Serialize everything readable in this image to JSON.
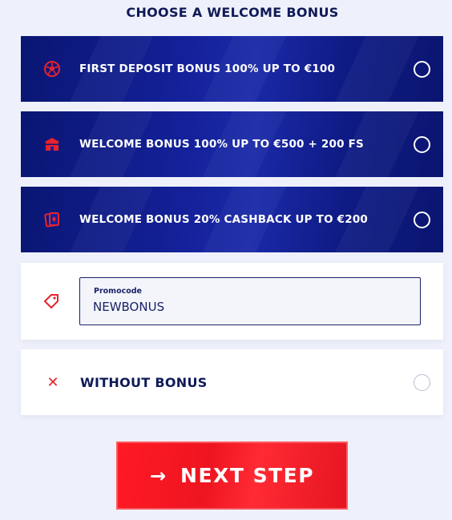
{
  "title": "CHOOSE A WELCOME BONUS",
  "options": [
    {
      "label": "FIRST DEPOSIT BONUS 100% UP TO €100",
      "icon": "soccer-ball-icon"
    },
    {
      "label": "WELCOME BONUS 100% UP TO €500 + 200 FS",
      "icon": "casino-building-icon"
    },
    {
      "label": "WELCOME BONUS 20% CASHBACK UP TO €200",
      "icon": "playing-cards-icon"
    }
  ],
  "promo": {
    "icon": "tag-icon",
    "label": "Promocode",
    "value": "NEWBONUS"
  },
  "without_bonus": {
    "icon": "close-icon",
    "label": "WITHOUT BONUS"
  },
  "next_button": {
    "arrow": "→",
    "label": "NEXT STEP"
  },
  "colors": {
    "accent_red": "#e8222e",
    "navy": "#0f1a57",
    "option_blue": "#14219a"
  }
}
